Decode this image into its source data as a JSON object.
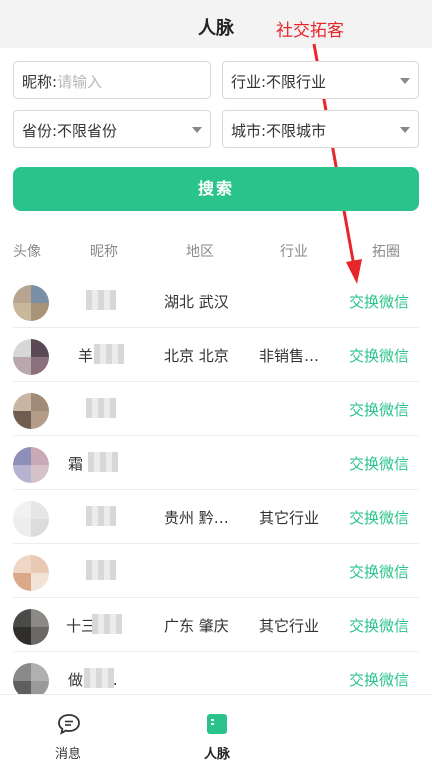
{
  "header": {
    "title": "人脉"
  },
  "annotation": "社交拓客",
  "filters": {
    "nickname_label": "昵称:",
    "nickname_placeholder": "请输入",
    "industry": "行业:不限行业",
    "province": "省份:不限省份",
    "city": "城市:不限城市"
  },
  "search_label": "搜索",
  "table": {
    "columns": [
      "头像",
      "昵称",
      "地区",
      "行业",
      "拓圈"
    ],
    "rows": [
      {
        "nickname": "",
        "region": "湖北 武汉",
        "industry": "",
        "action": "交换微信"
      },
      {
        "nickname": "羊  白",
        "region": "北京 北京",
        "industry": "非销售…",
        "action": "交换微信"
      },
      {
        "nickname": "",
        "region": "",
        "industry": "",
        "action": "交换微信"
      },
      {
        "nickname": "霜  5…",
        "region": "",
        "industry": "",
        "action": "交换微信"
      },
      {
        "nickname": "",
        "region": "贵州 黔…",
        "industry": "其它行业",
        "action": "交换微信"
      },
      {
        "nickname": "",
        "region": "",
        "industry": "",
        "action": "交换微信"
      },
      {
        "nickname": "十三  凉.",
        "region": "广东 肇庆",
        "industry": "其它行业",
        "action": "交换微信"
      },
      {
        "nickname": "做  文…",
        "region": "",
        "industry": "",
        "action": "交换微信"
      }
    ]
  },
  "tabs": [
    {
      "label": "消息",
      "icon": "chat-bubble-icon"
    },
    {
      "label": "人脉",
      "icon": "contacts-icon",
      "active": true
    }
  ],
  "colors": {
    "accent": "#2ac38b",
    "annotation": "#e8262a"
  }
}
